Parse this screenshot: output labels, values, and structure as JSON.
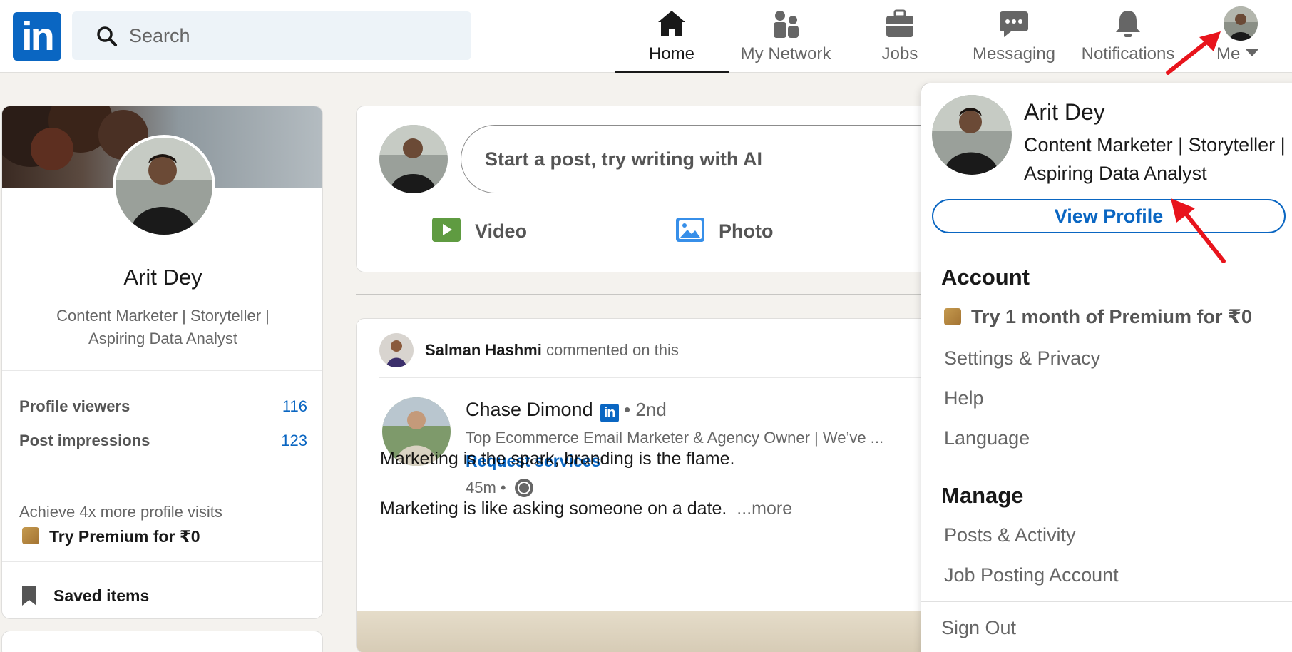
{
  "nav": {
    "search_placeholder": "Search",
    "items": [
      {
        "label": "Home",
        "icon": "home-icon"
      },
      {
        "label": "My Network",
        "icon": "network-icon"
      },
      {
        "label": "Jobs",
        "icon": "briefcase-icon"
      },
      {
        "label": "Messaging",
        "icon": "message-icon"
      },
      {
        "label": "Notifications",
        "icon": "bell-icon"
      }
    ],
    "me_label": "Me"
  },
  "profile": {
    "name": "Arit Dey",
    "headline": "Content Marketer | Storyteller | Aspiring Data Analyst",
    "stats": [
      {
        "label": "Profile viewers",
        "value": "116"
      },
      {
        "label": "Post impressions",
        "value": "123"
      }
    ],
    "achieve": "Achieve 4x more profile visits",
    "premium": "Try Premium for ₹0",
    "saved": "Saved items"
  },
  "composer": {
    "placeholder": "Start a post, try writing with AI",
    "actions": [
      {
        "label": "Video",
        "icon": "video-icon"
      },
      {
        "label": "Photo",
        "icon": "photo-icon"
      }
    ]
  },
  "post": {
    "social_actor": "Salman Hashmi",
    "social_action": "commented on this",
    "author": "Chase Dimond",
    "degree": "• 2nd",
    "headline": "Top Ecommerce Email Marketer & Agency Owner | We’ve ...",
    "request": "Request services",
    "time": "45m •",
    "line1": "Marketing is the spark, branding is the flame.",
    "line2": "Marketing is like asking someone on a date.",
    "more": "...more"
  },
  "dropdown": {
    "name": "Arit Dey",
    "headline": "Content Marketer | Storyteller | Aspiring Data Analyst",
    "view_profile": "View Profile",
    "account_title": "Account",
    "premium": "Try 1 month of Premium for ₹0",
    "account_items": [
      "Settings & Privacy",
      "Help",
      "Language"
    ],
    "manage_title": "Manage",
    "manage_items": [
      "Posts & Activity",
      "Job Posting Account"
    ],
    "sign_out": "Sign Out"
  },
  "colors": {
    "brand": "#0a66c2",
    "background": "#f4f2ee",
    "annotation": "#e8141c"
  }
}
